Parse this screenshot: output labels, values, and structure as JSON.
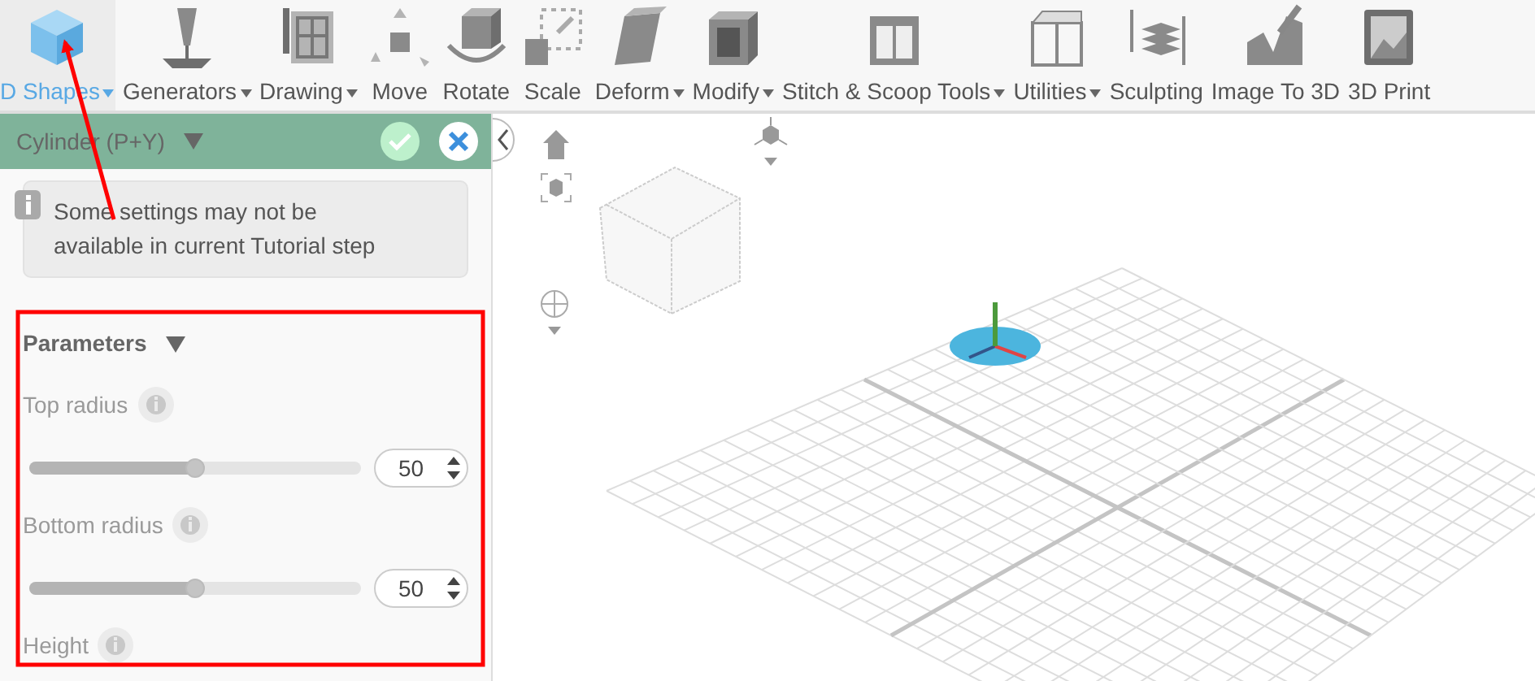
{
  "toolbar": [
    {
      "label": "D Shapes",
      "dropdown": true,
      "selected": true
    },
    {
      "label": "Generators",
      "dropdown": true,
      "selected": false
    },
    {
      "label": "Drawing",
      "dropdown": true,
      "selected": false
    },
    {
      "label": "Move",
      "dropdown": false,
      "selected": false
    },
    {
      "label": "Rotate",
      "dropdown": false,
      "selected": false
    },
    {
      "label": "Scale",
      "dropdown": false,
      "selected": false
    },
    {
      "label": "Deform",
      "dropdown": true,
      "selected": false
    },
    {
      "label": "Modify",
      "dropdown": true,
      "selected": false
    },
    {
      "label": "Stitch & Scoop Tools",
      "dropdown": true,
      "selected": false
    },
    {
      "label": "Utilities",
      "dropdown": true,
      "selected": false
    },
    {
      "label": "Sculpting",
      "dropdown": false,
      "selected": false
    },
    {
      "label": "Image To 3D",
      "dropdown": false,
      "selected": false
    },
    {
      "label": "3D Print",
      "dropdown": false,
      "selected": false
    }
  ],
  "panel": {
    "title": "Cylinder (P+Y)",
    "notice": "Some settings may not be available in current Tutorial step",
    "section": {
      "title": "Parameters",
      "expanded": true,
      "params": [
        {
          "label": "Top radius",
          "disabled": true,
          "level": 0.5,
          "value": "50"
        },
        {
          "label": "Bottom radius",
          "disabled": true,
          "level": 0.5,
          "value": "50"
        },
        {
          "label": "Height",
          "disabled": true
        }
      ]
    }
  }
}
